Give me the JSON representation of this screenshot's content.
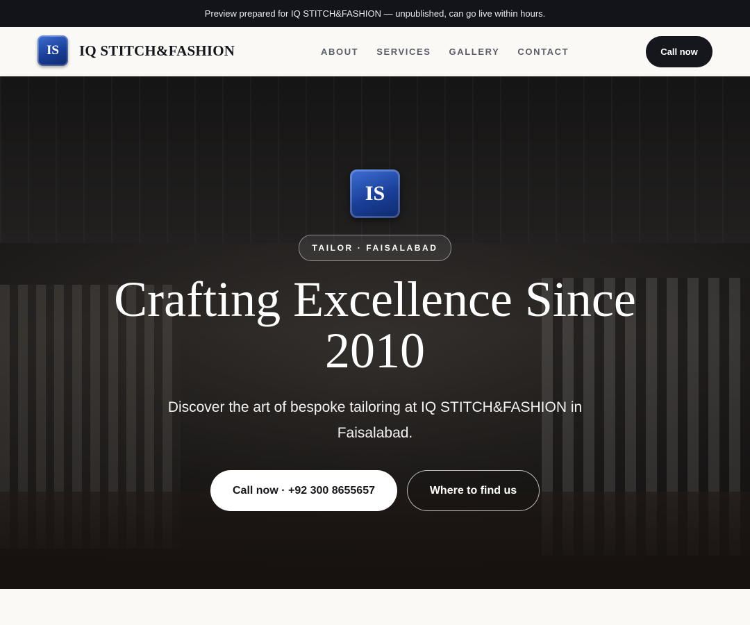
{
  "preview_banner": "Preview prepared for IQ STITCH&FASHION — unpublished, can go live within hours.",
  "navbar": {
    "logo_initials": "IS",
    "brand_name": "IQ STITCH&FASHION",
    "links": [
      "ABOUT",
      "SERVICES",
      "GALLERY",
      "CONTACT"
    ],
    "cta_label": "Call now"
  },
  "hero": {
    "logo_initials": "IS",
    "tag": "TAILOR · FAISALABAD",
    "title": "Crafting Excellence Since 2010",
    "subtitle": "Discover the art of bespoke tailoring at IQ STITCH&FASHION in Faisalabad.",
    "primary_button": "Call now · +92 300 8655657",
    "secondary_button": "Where to find us"
  },
  "colors": {
    "topbar_bg": "#131419",
    "accent_dark": "#16171c",
    "logo_blue": "#1a3f98",
    "page_bg": "#faf9f6"
  }
}
